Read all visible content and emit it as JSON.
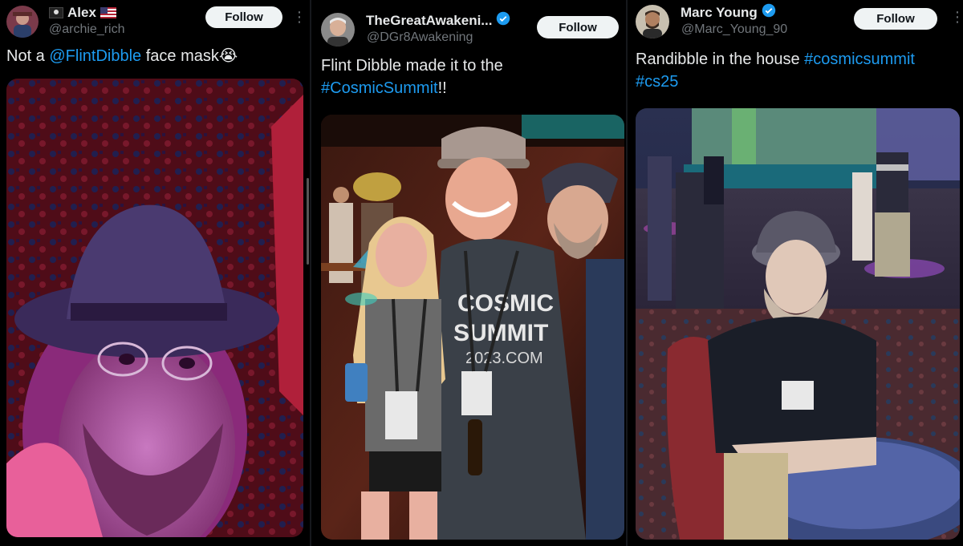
{
  "posts": [
    {
      "name": "Alex",
      "name_prefix_icon": "pirate-flag-icon",
      "name_suffix_icon": "us-flag-icon",
      "handle": "@archie_rich",
      "follow_label": "Follow",
      "text_before": "Not a ",
      "mention": "@FlintDibble",
      "text_after": " face mask",
      "emoji": "😭",
      "verified": false
    },
    {
      "name": "TheGreatAwakeni...",
      "handle": "@DGr8Awakening",
      "follow_label": "Follow",
      "text_line1": "Flint Dibble made it to the",
      "hashtag": "#CosmicSummit",
      "text_after": "!!",
      "verified": true
    },
    {
      "name": "Marc Young",
      "handle": "@Marc_Young_90",
      "follow_label": "Follow",
      "text_before": "Randibble in the house ",
      "hashtag1": "#cosmicsummit",
      "hashtag2": "#cs25",
      "verified": true
    }
  ],
  "photo_text": {
    "shirt_lines": [
      "COSMIC",
      "SUMMIT",
      "2023.COM"
    ]
  },
  "colors": {
    "link": "#1d9bf0",
    "verified": "#1d9bf0",
    "follow_bg": "#eff3f4"
  }
}
